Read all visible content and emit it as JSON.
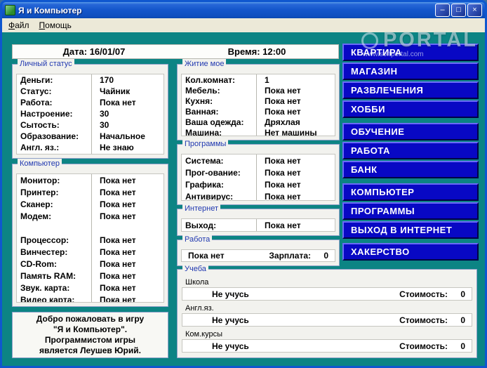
{
  "window": {
    "title": "Я и Компьютер",
    "controls": {
      "minimize": "–",
      "maximize": "□",
      "close": "×"
    }
  },
  "menu": {
    "file": "Файл",
    "help": "Помощь"
  },
  "watermark": {
    "big": "PORTAL",
    "url": "www.softportal.com"
  },
  "topbar": {
    "date": "Дата: 16/01/07",
    "time": "Время: 12:00"
  },
  "groups": {
    "personal": {
      "title": "Личный статус",
      "rows": [
        {
          "label": "Деньги:",
          "value": "170"
        },
        {
          "label": "Статус:",
          "value": "Чайник"
        },
        {
          "label": "Работа:",
          "value": "Пока нет"
        },
        {
          "label": "Настроение:",
          "value": "30"
        },
        {
          "label": "Сытость:",
          "value": "30"
        },
        {
          "label": "Образование:",
          "value": "Начальное"
        },
        {
          "label": "Англ. яз.:",
          "value": "Не знаю"
        }
      ]
    },
    "computer": {
      "title": "Компьютер",
      "rows": [
        {
          "label": "Монитор:",
          "value": "Пока нет"
        },
        {
          "label": "Принтер:",
          "value": "Пока нет"
        },
        {
          "label": "Сканер:",
          "value": "Пока нет"
        },
        {
          "label": "Модем:",
          "value": "Пока нет"
        },
        {
          "label": "",
          "value": ""
        },
        {
          "label": "Процессор:",
          "value": "Пока нет"
        },
        {
          "label": "Винчестер:",
          "value": "Пока нет"
        },
        {
          "label": "CD-Rom:",
          "value": "Пока нет"
        },
        {
          "label": "Память RAM:",
          "value": "Пока нет"
        },
        {
          "label": "Звук. карта:",
          "value": "Пока нет"
        },
        {
          "label": "Видео карта:",
          "value": "Пока нет"
        }
      ]
    },
    "life": {
      "title": "Житие мое",
      "rows": [
        {
          "label": "Кол.комнат:",
          "value": "1"
        },
        {
          "label": "Мебель:",
          "value": "Пока нет"
        },
        {
          "label": "Кухня:",
          "value": "Пока нет"
        },
        {
          "label": "Ванная:",
          "value": "Пока нет"
        },
        {
          "label": "Ваша одежда:",
          "value": "Дряхлая"
        },
        {
          "label": "Машина:",
          "value": "Нет машины"
        }
      ]
    },
    "programs": {
      "title": "Программы",
      "rows": [
        {
          "label": "Система:",
          "value": "Пока нет"
        },
        {
          "label": "Прог-ование:",
          "value": "Пока нет"
        },
        {
          "label": "Графика:",
          "value": "Пока нет"
        },
        {
          "label": "Антивирус:",
          "value": "Пока нет"
        }
      ]
    },
    "internet": {
      "title": "Интернет",
      "rows": [
        {
          "label": "Выход:",
          "value": "Пока нет"
        }
      ]
    },
    "work": {
      "title": "Работа",
      "status": "Пока нет",
      "salary_label": "Зарплата:",
      "salary_value": "0"
    },
    "study": {
      "title": "Учеба",
      "items": [
        {
          "name": "Школа",
          "status": "Не учусь",
          "cost_label": "Стоимость:",
          "cost": "0"
        },
        {
          "name": "Англ.яз.",
          "status": "Не учусь",
          "cost_label": "Стоимость:",
          "cost": "0"
        },
        {
          "name": "Ком.курсы",
          "status": "Не учусь",
          "cost_label": "Стоимость:",
          "cost": "0"
        }
      ]
    }
  },
  "welcome": {
    "text": "Добро пожаловать в игру\n\"Я и Компьютер\".\nПрограммистом игры\nявляется Леушев Юрий."
  },
  "nav_buttons": [
    "КВАРТИРА",
    "МАГАЗИН",
    "РАЗВЛЕЧЕНИЯ",
    "ХОББИ",
    "ОБУЧЕНИЕ",
    "РАБОТА",
    "БАНК",
    "КОМПЬЮТЕР",
    "ПРОГРАММЫ",
    "ВЫХОД В ИНТЕРНЕТ",
    "ХАКЕРСТВО"
  ],
  "colors": {
    "background_teal": "#0c8484",
    "nav_button_blue": "#0808c4",
    "group_title_blue": "#2038b0",
    "titlebar_blue": "#1557cc"
  }
}
